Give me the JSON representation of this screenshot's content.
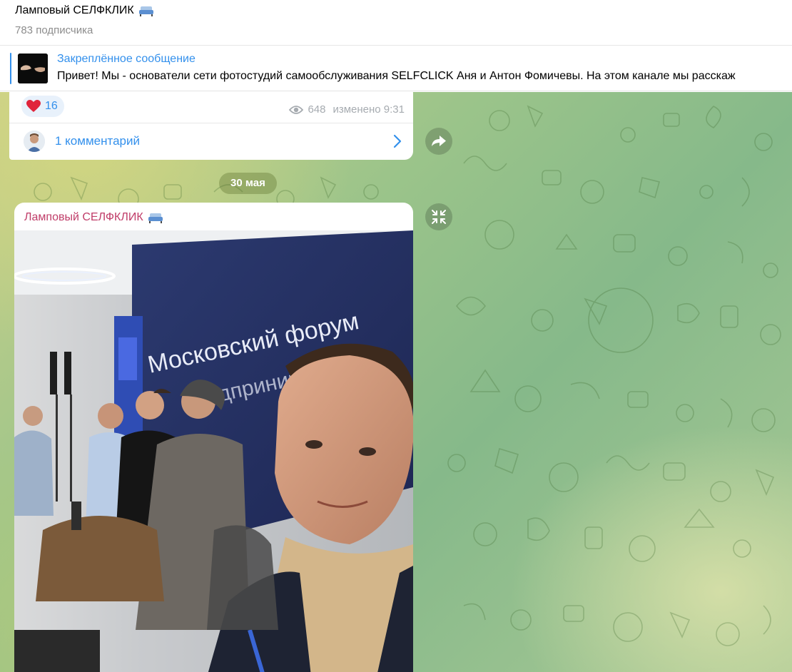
{
  "header": {
    "title": "Ламповый СЕЛФКЛИК",
    "title_icon": "sofa-emoji",
    "subscribers": "783 подписчика"
  },
  "pinned": {
    "title": "Закреплённое сообщение",
    "text": "Привет!  Мы - основатели сети фотостудий самообслуживания SELFCLICK Аня и Антон Фомичевы.  На этом канале мы расскаж"
  },
  "previous_message": {
    "reaction": {
      "icon": "heart-icon",
      "count": "16"
    },
    "views": "648",
    "edited_time": "изменено 9:31",
    "comments_label": "1 комментарий"
  },
  "date_separator": "30 мая",
  "post": {
    "author": "Ламповый СЕЛФКЛИК",
    "author_icon": "sofa-emoji"
  },
  "colors": {
    "accent": "#3390ec",
    "author": "#c03d69",
    "muted": "#8d8d8d"
  }
}
